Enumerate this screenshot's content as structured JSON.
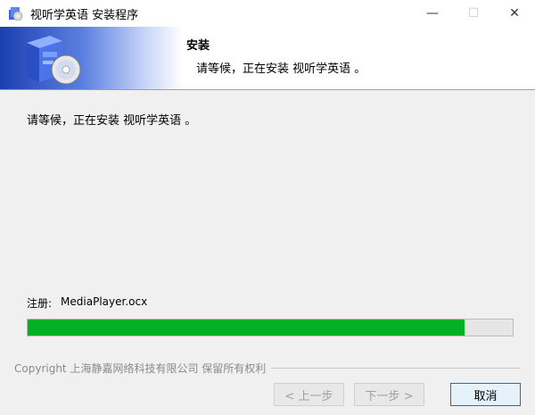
{
  "window": {
    "title": "视听学英语 安装程序",
    "minimize": "—",
    "maximize": "☐",
    "close": "✕"
  },
  "header": {
    "title": "安装",
    "subtitle": "请等候，正在安装 视听学英语 。"
  },
  "main": {
    "status": "请等候，正在安装 视听学英语 。",
    "register_label": "注册:",
    "register_file": "MediaPlayer.ocx",
    "progress": 0.9
  },
  "footer": {
    "copyright": "Copyright 上海静嘉网络科技有限公司 保留所有权利",
    "back_label": "< 上一步",
    "next_label": "下一步 >",
    "cancel_label": "取消"
  },
  "colors": {
    "progress_fill": "#06b025",
    "accent": "#0078d7"
  }
}
